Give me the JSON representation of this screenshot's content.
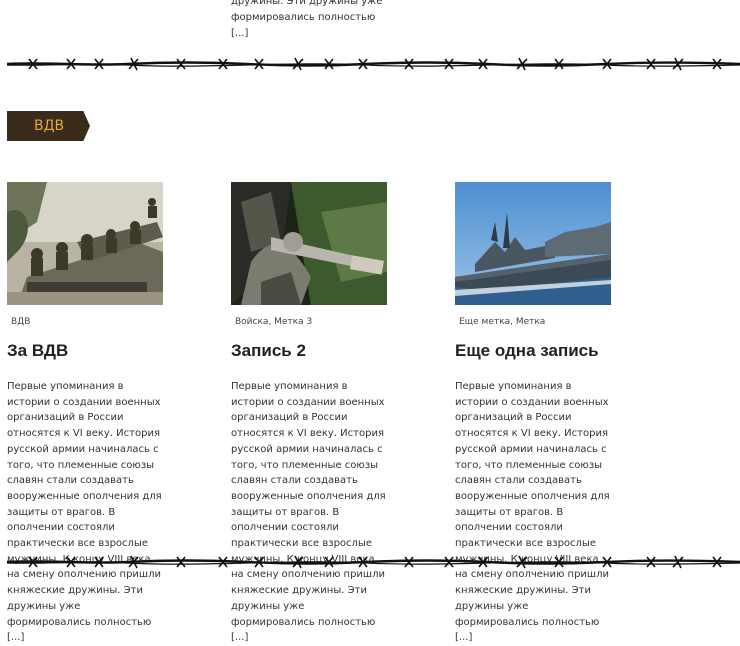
{
  "top_excerpt": {
    "line1": "дружины. Эти дружины уже",
    "line2": "формировались полностью",
    "more": "[...]"
  },
  "category": {
    "label": "ВДВ",
    "text_color": "#e2a54a",
    "bg_color": "#3a2c1a"
  },
  "posts": [
    {
      "tags": [
        "ВДВ"
      ],
      "title": "За ВДВ",
      "image": "soldiers-on-armored-vehicle",
      "excerpt": "Первые упоминания в истории о создании военных организаций в России относятся к VI веку. История русской армии начиналась с того, что племенные союзы славян стали создавать вооруженные ополчения для защиты от врагов. В ополчении состояли практически все взрослые мужчины. К концу VIII века на смену ополчению пришли княжеские дружины. Эти дружины уже формировались полностью",
      "more": "[...]"
    },
    {
      "tags": [
        "Войска",
        "Метка 3"
      ],
      "title": "Запись 2",
      "image": "sniper-rifle",
      "excerpt": "Первые упоминания в истории о создании военных организаций в России относятся к VI веку. История русской армии начиналась с того, что племенные союзы славян стали создавать вооруженные ополчения для защиты от врагов. В ополчении состояли практически все взрослые мужчины. К концу VIII века на смену ополчению пришли княжеские дружины. Эти дружины уже формировались полностью",
      "more": "[...]"
    },
    {
      "tags": [
        "Еще метка",
        "Метка"
      ],
      "title": "Еще одна запись",
      "image": "warship-at-sea",
      "excerpt": "Первые упоминания в истории о создании военных организаций в России относятся к VI веку. История русской армии начиналась с того, что племенные союзы славян стали создавать вооруженные ополчения для защиты от врагов. В ополчении состояли практически все взрослые мужчины. К концу VIII века на смену ополчению пришли княжеские дружины. Эти дружины уже формировались полностью",
      "more": "[...]"
    }
  ]
}
